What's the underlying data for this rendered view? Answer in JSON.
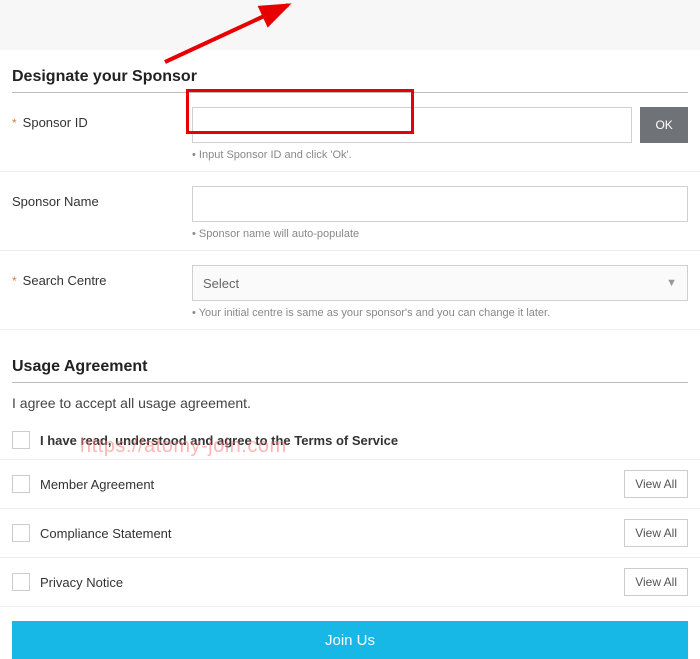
{
  "watermark": "https://atomy-join.com",
  "sections": {
    "sponsor": {
      "title": "Designate your Sponsor",
      "sponsor_id": {
        "label": "Sponsor ID",
        "hint": "Input Sponsor ID and click 'Ok'.",
        "ok_label": "OK"
      },
      "sponsor_name": {
        "label": "Sponsor Name",
        "hint": "Sponsor name will auto-populate"
      },
      "search_centre": {
        "label": "Search Centre",
        "selected": "Select",
        "hint": "Your initial centre is same as your sponsor's and you can change it later."
      }
    },
    "agreement": {
      "title": "Usage Agreement",
      "intro": "I agree to accept all usage agreement.",
      "master_label": "I have read, understood and agree to the Terms of Service",
      "items": [
        {
          "label": "Member Agreement",
          "view": "View All"
        },
        {
          "label": "Compliance Statement",
          "view": "View All"
        },
        {
          "label": "Privacy Notice",
          "view": "View All"
        }
      ]
    },
    "join_label": "Join Us"
  }
}
